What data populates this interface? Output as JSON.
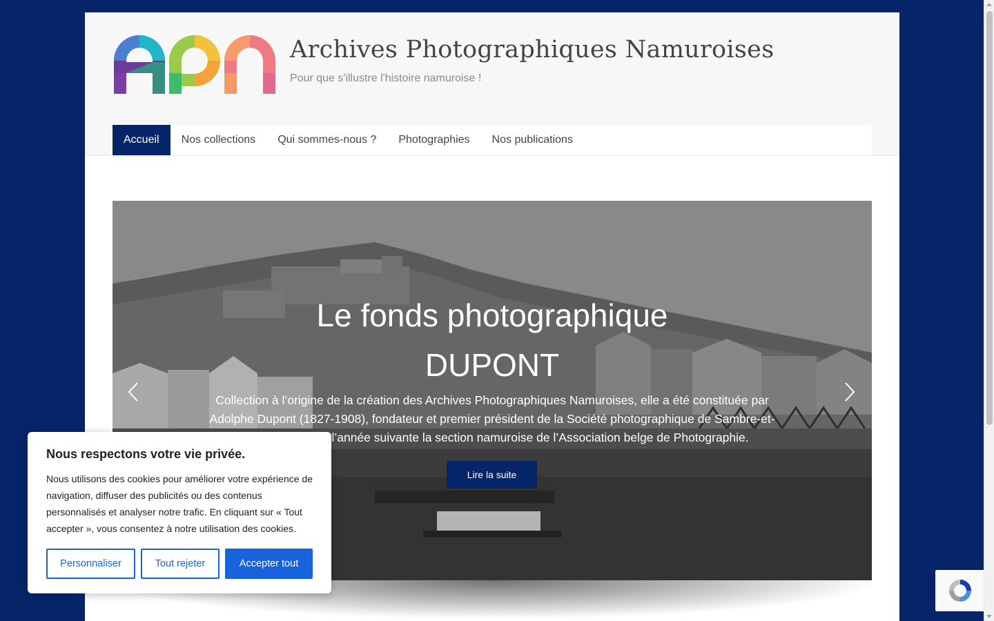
{
  "site": {
    "title": "Archives Photographiques Namuroises",
    "tagline": "Pour que s'illustre l'histoire namuroise !",
    "logo_letters": "APN"
  },
  "nav": {
    "items": [
      {
        "label": "Accueil",
        "active": true
      },
      {
        "label": "Nos collections",
        "active": false
      },
      {
        "label": "Qui sommes-nous ?",
        "active": false
      },
      {
        "label": "Photographies",
        "active": false
      },
      {
        "label": "Nos publications",
        "active": false
      }
    ]
  },
  "slide": {
    "title_line1": "Le fonds photographique",
    "title_line2": "DUPONT",
    "text_line1": "Collection à l’origine de la création des Archives Photographiques Namuroises, elle a été constituée par",
    "text_line2": "Adolphe Dupont (1827-1908), fondateur et premier président de la Société photographique de Sambre-et-",
    "text_line3": "Meuse, qui fonde l’année suivante la section namuroise de l’Association belge de Photographie.",
    "button_label": "Lire la suite",
    "prev_icon": "chevron-left-icon",
    "next_icon": "chevron-right-icon"
  },
  "cookie": {
    "title": "Nous respectons votre vie privée.",
    "text": "Nous utilisons des cookies pour améliorer votre expérience de navigation, diffuser des publicités ou des contenus personnalisés et analyser notre trafic. En cliquant sur « Tout accepter », vous consentez à notre utilisation des cookies.",
    "customize_label": "Personnaliser",
    "reject_label": "Tout rejeter",
    "accept_label": "Accepter tout"
  },
  "colors": {
    "brand_navy": "#062569",
    "cookie_blue": "#1863dc",
    "background": "#062569"
  },
  "icons": {
    "recaptcha": "recaptcha-icon"
  }
}
